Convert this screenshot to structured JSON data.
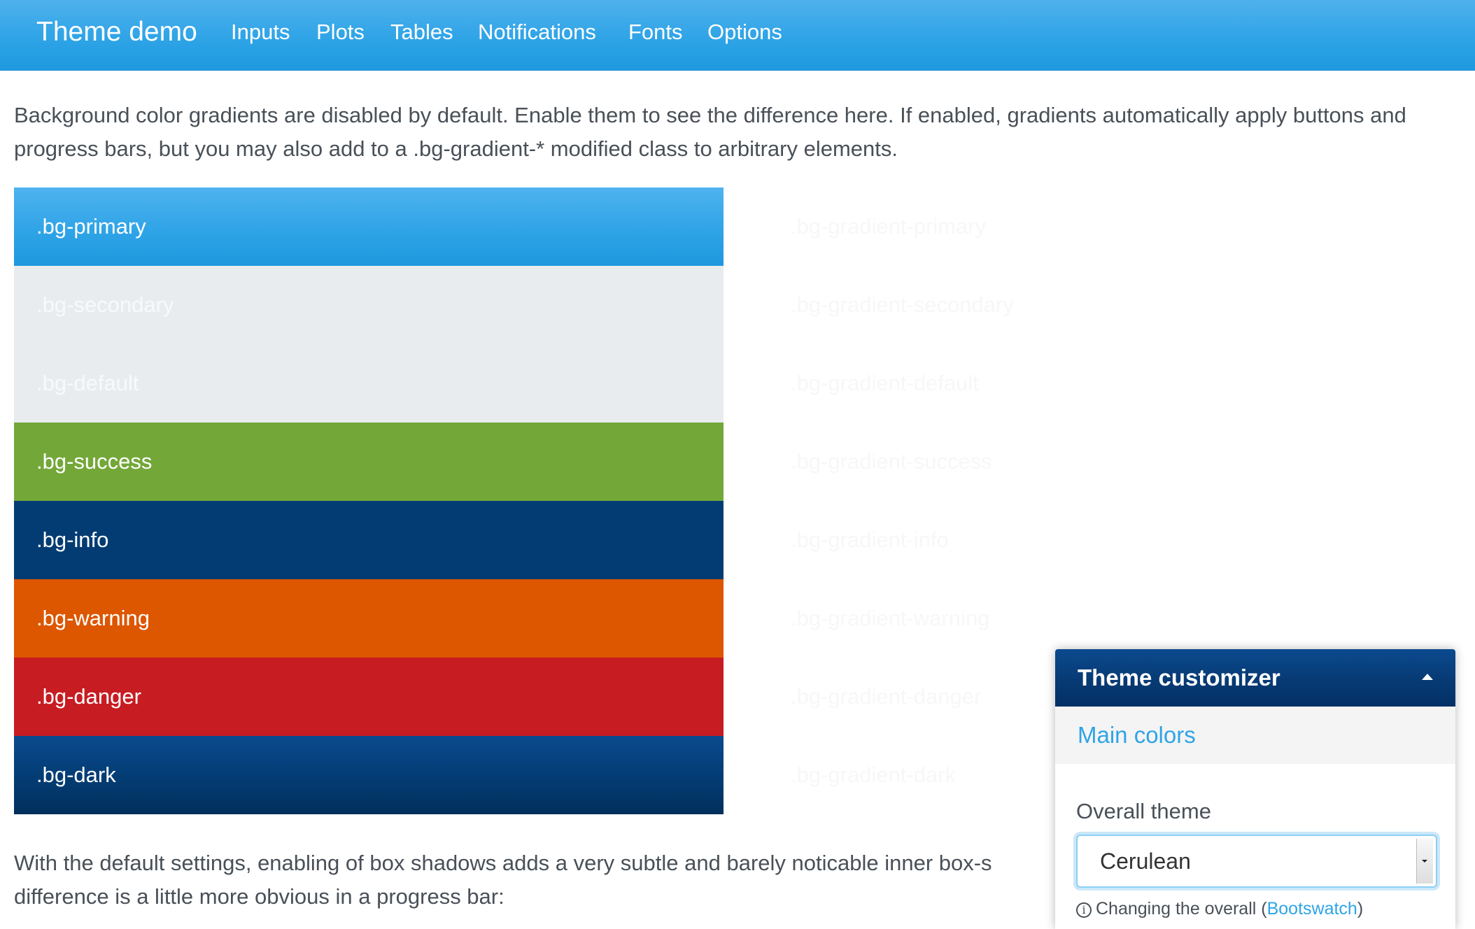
{
  "navbar": {
    "brand": "Theme demo",
    "items": [
      "Inputs",
      "Plots",
      "Tables",
      "Notifications",
      "Fonts",
      "Options"
    ]
  },
  "intro_text": "Background color gradients are disabled by default. Enable them to see the difference here. If enabled, gradients automatically apply buttons and progress bars, but you may also add to a .bg-gradient-* modified class to arbitrary elements.",
  "swatches": [
    {
      "label": ".bg-primary",
      "gradient_label": ".bg-gradient-primary",
      "color": "#2fa4e7",
      "text_color": "#ffffff"
    },
    {
      "label": ".bg-secondary",
      "gradient_label": ".bg-gradient-secondary",
      "color": "#e9ecef",
      "text_color": "#f8f9fa"
    },
    {
      "label": ".bg-default",
      "gradient_label": ".bg-gradient-default",
      "color": "#e9ecef",
      "text_color": "#f8f9fa"
    },
    {
      "label": ".bg-success",
      "gradient_label": ".bg-gradient-success",
      "color": "#73a839",
      "text_color": "#ffffff"
    },
    {
      "label": ".bg-info",
      "gradient_label": ".bg-gradient-info",
      "color": "#033c73",
      "text_color": "#ffffff"
    },
    {
      "label": ".bg-warning",
      "gradient_label": ".bg-gradient-warning",
      "color": "#dd5600",
      "text_color": "#ffffff"
    },
    {
      "label": ".bg-danger",
      "gradient_label": ".bg-gradient-danger",
      "color": "#c71c22",
      "text_color": "#ffffff"
    },
    {
      "label": ".bg-dark",
      "gradient_label": ".bg-gradient-dark",
      "color": "#033c73",
      "text_color": "#ffffff"
    }
  ],
  "outro_text": {
    "line1": "With the default settings, enabling of box shadows adds a very subtle and barely noticable inner box-s",
    "line2": "difference is a little more obvious in a progress bar:"
  },
  "customizer": {
    "title": "Theme customizer",
    "section": "Main colors",
    "field_label": "Overall theme",
    "selected_theme": "Cerulean",
    "help_prefix": "Changing the overall (",
    "help_link": "Bootswatch",
    "help_suffix": ")",
    "info_glyph": "i"
  },
  "colors": {
    "navbar": "#2fa4e7",
    "link": "#2fa4e7",
    "customizer_header": "#033c73"
  }
}
